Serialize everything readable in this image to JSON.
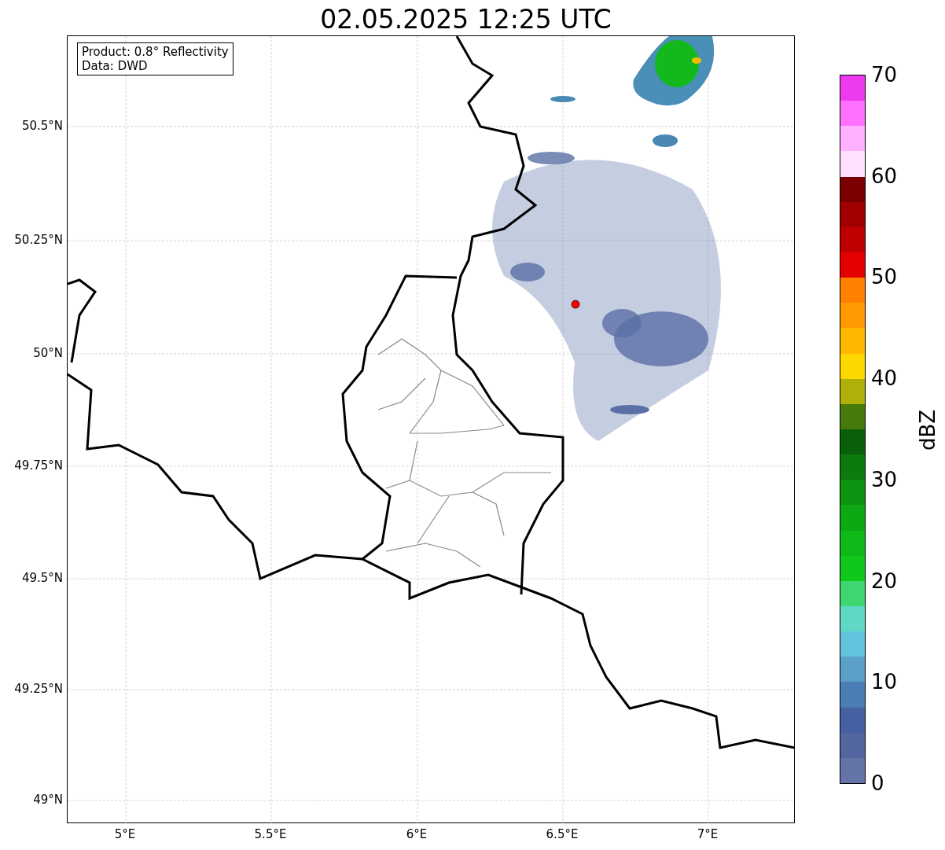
{
  "title": "02.05.2025 12:25 UTC",
  "info": [
    "Product: 0.8° Reflectivity",
    "Data: DWD"
  ],
  "y_ticks": [
    "50.5°N",
    "50.25°N",
    "50°N",
    "49.75°N",
    "49.5°N",
    "49.25°N",
    "49°N"
  ],
  "x_ticks": [
    "5°E",
    "5.5°E",
    "6°E",
    "6.5°E",
    "7°E"
  ],
  "colorbar": {
    "label": "dBZ",
    "ticks": [
      "70",
      "60",
      "50",
      "40",
      "30",
      "20",
      "10",
      "0"
    ],
    "segments": [
      {
        "color": "#ee3aee"
      },
      {
        "color": "#ff70ff"
      },
      {
        "color": "#ffb0ff"
      },
      {
        "color": "#ffe0ff"
      },
      {
        "color": "#7a0000"
      },
      {
        "color": "#a00000"
      },
      {
        "color": "#c00000"
      },
      {
        "color": "#e40000"
      },
      {
        "color": "#ff7f00"
      },
      {
        "color": "#ff9a00"
      },
      {
        "color": "#ffb700"
      },
      {
        "color": "#ffd700"
      },
      {
        "color": "#b0b00a"
      },
      {
        "color": "#467a0a"
      },
      {
        "color": "#08600a"
      },
      {
        "color": "#0c7a0c"
      },
      {
        "color": "#0d9410"
      },
      {
        "color": "#0ea814"
      },
      {
        "color": "#0fba18"
      },
      {
        "color": "#10c81c"
      },
      {
        "color": "#3dd670"
      },
      {
        "color": "#5fd8c6"
      },
      {
        "color": "#62c4dc"
      },
      {
        "color": "#5aa0c8"
      },
      {
        "color": "#4a7db4"
      },
      {
        "color": "#4560a3"
      },
      {
        "color": "#5366a0"
      },
      {
        "color": "#6474a6"
      }
    ]
  }
}
